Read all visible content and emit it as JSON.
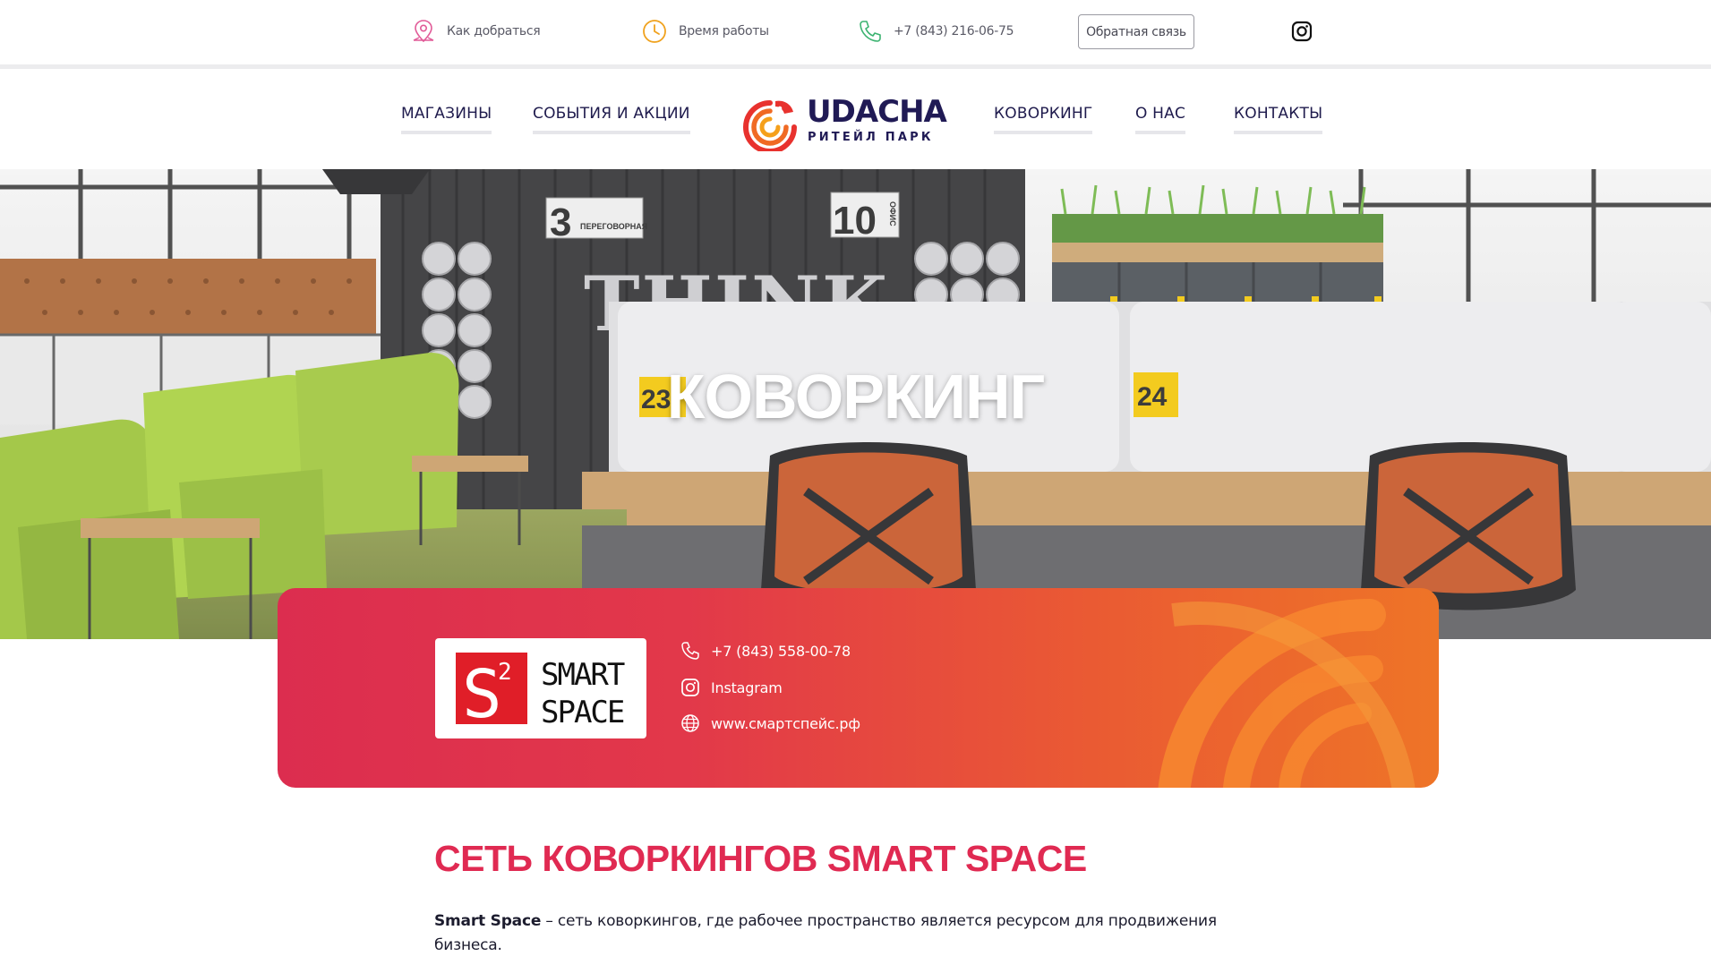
{
  "topbar": {
    "route_label": "Как добраться",
    "hours_label": "Время работы",
    "phone": "+7 (843) 216-06-75",
    "feedback_label": "Обратная связь",
    "icons": [
      "map-pin-icon",
      "clock-icon",
      "phone-icon",
      "instagram-icon"
    ],
    "colors": {
      "route": "#e15a97",
      "hours": "#f0a21e",
      "phone": "#3cb371"
    }
  },
  "nav": {
    "items": [
      "МАГАЗИНЫ",
      "СОБЫТИЯ И АКЦИИ",
      "КОВОРКИНГ",
      "О НАС",
      "КОНТАКТЫ"
    ],
    "logo_word": "UDACHA",
    "logo_sub": "РИТЕЙЛ ПАРК"
  },
  "hero": {
    "title": "КОВОРКИНГ",
    "scene_text": {
      "sign_3": "3",
      "sign_3_label": "ПЕРЕГОВОРНАЯ",
      "sign_10": "10",
      "sign_10_label": "ОФИС",
      "wall_text": "THINK",
      "desk_23": "23",
      "desk_24": "24"
    }
  },
  "card": {
    "logo_mark": "S",
    "logo_sup": "2",
    "logo_line1": "SMART",
    "logo_line2": "SPACE",
    "phone": "+7 (843) 558-00-78",
    "instagram": "Instagram",
    "website": "www.смартспейс.рф",
    "gradient": [
      "#dc2d4f",
      "#ee7427"
    ]
  },
  "content": {
    "title": "СЕТЬ КОВОРКИНГОВ SMART SPACE",
    "lead_bold": "Smart Space",
    "lead_rest": " – сеть коворкингов, где рабочее пространство является ресурсом для продвижения бизнеса.",
    "accent": "#e02a52"
  }
}
